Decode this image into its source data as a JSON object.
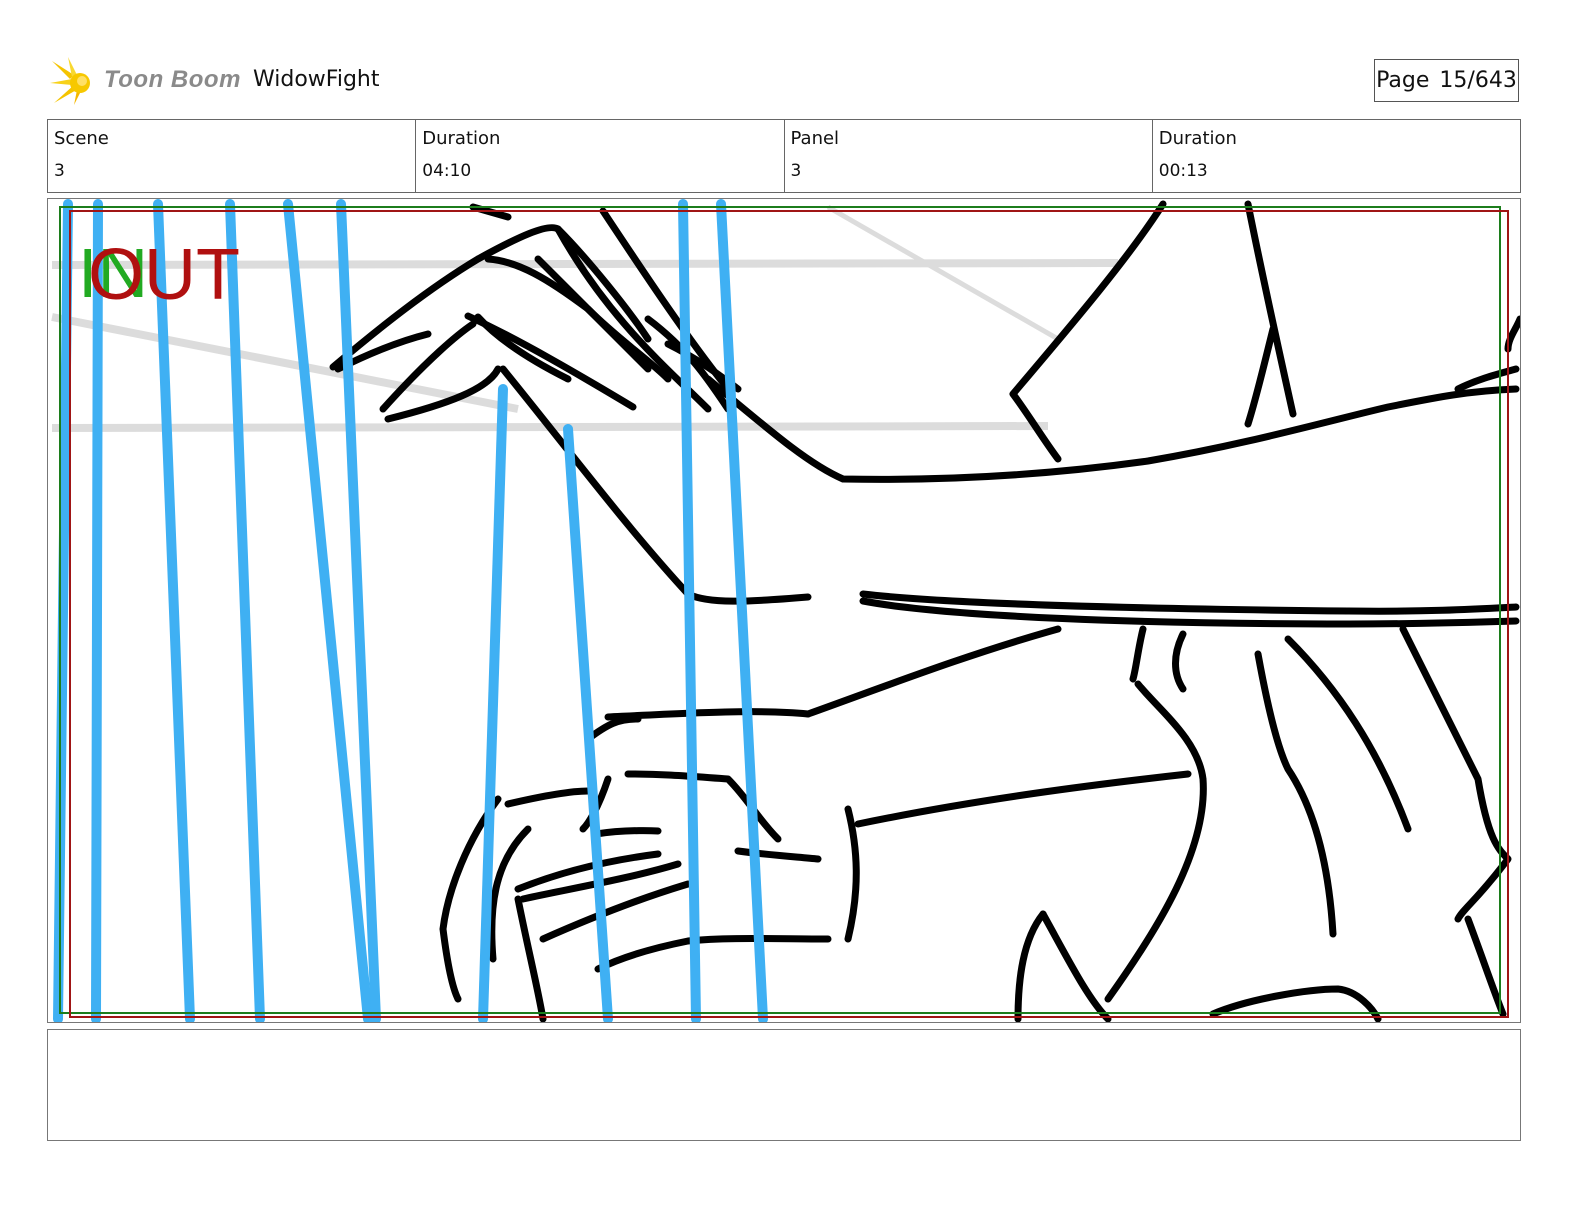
{
  "header": {
    "brand": "Toon Boom",
    "project_title": "WidowFight",
    "page_label": "Page",
    "page_value": "15/643"
  },
  "info": {
    "scene_label": "Scene",
    "scene_value": "3",
    "scene_duration_label": "Duration",
    "scene_duration_value": "04:10",
    "panel_label": "Panel",
    "panel_value": "3",
    "panel_duration_label": "Duration",
    "panel_duration_value": "00:13"
  },
  "panel": {
    "in_marker": "IN",
    "out_marker": "OUT"
  },
  "caption": {
    "text": ""
  },
  "colors": {
    "in_marker": "#22aa22",
    "out_marker": "#b01010",
    "rain_lines": "#3fb0f3",
    "sketch": "#000000"
  }
}
